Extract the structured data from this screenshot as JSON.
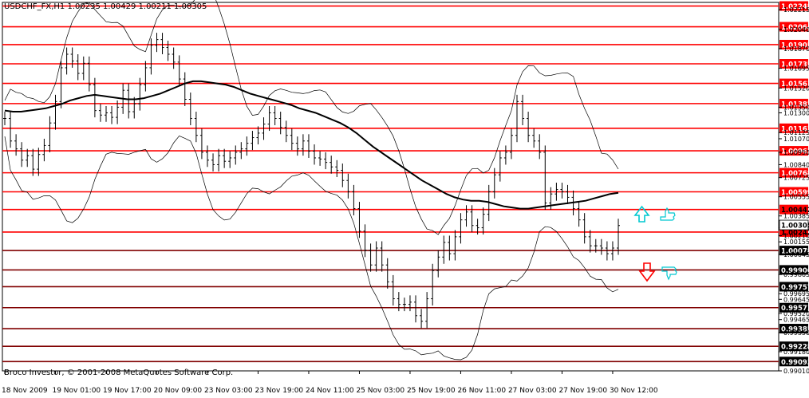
{
  "header": {
    "title": "USDCHF_FX,H1  1.00235 1.00429 1.00211 1.00305"
  },
  "footer": {
    "copyright": "Broco Investor, © 2001-2008 MetaQuotes Software Corp."
  },
  "colors": {
    "background": "#ffffff",
    "frame": "#000000",
    "red_level": "#ff0000",
    "dark_level": "#800000",
    "level_label_bg": "#ff0000",
    "level_label_fg": "#ffffff",
    "up_arrow": "#00c8d0",
    "down_arrow": "#ff0000",
    "candles": "#000000"
  },
  "chart_data": {
    "type": "line",
    "symbol": "USDCHF_FX",
    "timeframe": "H1",
    "ohlc_last": {
      "open": 1.00235,
      "high": 1.00429,
      "low": 1.00211,
      "close": 1.00305
    },
    "y_range": [
      0.9901,
      1.0228
    ],
    "x_labels": [
      "18 Nov 2009",
      "19 Nov 01:00",
      "19 Nov 17:00",
      "20 Nov 09:00",
      "23 Nov 03:00",
      "23 Nov 19:00",
      "24 Nov 11:00",
      "25 Nov 03:00",
      "25 Nov 19:00",
      "26 Nov 11:00",
      "27 Nov 03:00",
      "27 Nov 19:00",
      "30 Nov 12:00"
    ],
    "x_index": [
      0,
      9,
      18,
      27,
      36,
      45,
      54,
      63,
      72,
      81,
      90,
      99,
      108
    ],
    "y_ticks": [
      "1.02215",
      "1.02040",
      "1.01870",
      "1.01695",
      "1.01520",
      "1.01350",
      "1.01300",
      "1.01125",
      "1.01070",
      "1.00950",
      "1.00840",
      "1.00725",
      "1.00555",
      "1.00385",
      "1.00280",
      "1.00210",
      "1.00155",
      "1.00045",
      "0.99865",
      "0.99695",
      "0.99645",
      "0.99520",
      "0.99465",
      "0.99350",
      "0.99180",
      "0.99010"
    ],
    "price_levels_red": [
      "1.00442",
      "1.00242"
    ],
    "price_levels_white_label": [
      "1.02248",
      "1.02064",
      "1.01905",
      "1.01735",
      "1.01561",
      "1.01382",
      "1.01163",
      "1.00963",
      "1.00768",
      "1.00599"
    ],
    "price_levels_dark": [
      "1.00078",
      "0.99906",
      "0.99757",
      "0.99571",
      "0.99385",
      "0.99228",
      "0.99093"
    ],
    "current_price": "1.00305",
    "series": [
      {
        "kind": "close",
        "values": [
          1.0125,
          1.0105,
          1.0098,
          1.0088,
          1.0092,
          1.008,
          1.0093,
          1.0101,
          1.0121,
          1.014,
          1.017,
          1.0182,
          1.0176,
          1.0165,
          1.0174,
          1.0155,
          1.0132,
          1.0128,
          1.013,
          1.0126,
          1.0135,
          1.015,
          1.0131,
          1.0138,
          1.0155,
          1.017,
          1.019,
          1.0195,
          1.0188,
          1.0182,
          1.0175,
          1.016,
          1.0142,
          1.0125,
          1.011,
          1.0095,
          1.0088,
          1.0084,
          1.0092,
          1.0087,
          1.009,
          1.0095,
          1.0098,
          1.0103,
          1.0108,
          1.0112,
          1.012,
          1.013,
          1.0125,
          1.0117,
          1.011,
          1.0103,
          1.0098,
          1.0105,
          1.0096,
          1.009,
          1.0089,
          1.0086,
          1.0082,
          1.0079,
          1.007,
          1.006,
          1.0045,
          1.0025,
          1.0008,
          0.9995,
          1.001,
          0.9995,
          0.998,
          0.9965,
          0.996,
          0.996,
          0.9962,
          0.995,
          0.9945,
          0.9965,
          0.999,
          1.0002,
          1.0015,
          1.0005,
          1.002,
          1.0035,
          1.0042,
          1.003,
          1.0028,
          1.004,
          1.006,
          1.0075,
          1.009,
          1.0095,
          1.011,
          1.014,
          1.0125,
          1.011,
          1.0105,
          1.0095,
          1.005,
          1.0058,
          1.0062,
          1.006,
          1.0055,
          1.0045,
          1.0035,
          1.002,
          1.0012,
          1.0012,
          1.001,
          1.0005,
          1.001,
          1.003
        ]
      },
      {
        "kind": "moving_average",
        "values": [
          1.0132,
          1.0131,
          1.0131,
          1.0132,
          1.0133,
          1.0134,
          1.0136,
          1.0138,
          1.0141,
          1.0143,
          1.0145,
          1.0146,
          1.0145,
          1.0144,
          1.0143,
          1.0142,
          1.0142,
          1.0143,
          1.0145,
          1.0147,
          1.015,
          1.0153,
          1.0156,
          1.0158,
          1.0158,
          1.0157,
          1.0156,
          1.0155,
          1.0153,
          1.015,
          1.0147,
          1.0145,
          1.0143,
          1.0141,
          1.0139,
          1.0137,
          1.0134,
          1.0132,
          1.013,
          1.0127,
          1.0124,
          1.0121,
          1.0117,
          1.0112,
          1.0106,
          1.01,
          1.0095,
          1.009,
          1.0085,
          1.008,
          1.0075,
          1.007,
          1.0066,
          1.0062,
          1.0058,
          1.0055,
          1.0053,
          1.0052,
          1.0052,
          1.0051,
          1.0049,
          1.0047,
          1.0046,
          1.0045,
          1.0045,
          1.0046,
          1.0047,
          1.0048,
          1.0049,
          1.005,
          1.0051,
          1.0052,
          1.0054,
          1.0056,
          1.0058,
          1.0059
        ]
      }
    ]
  }
}
